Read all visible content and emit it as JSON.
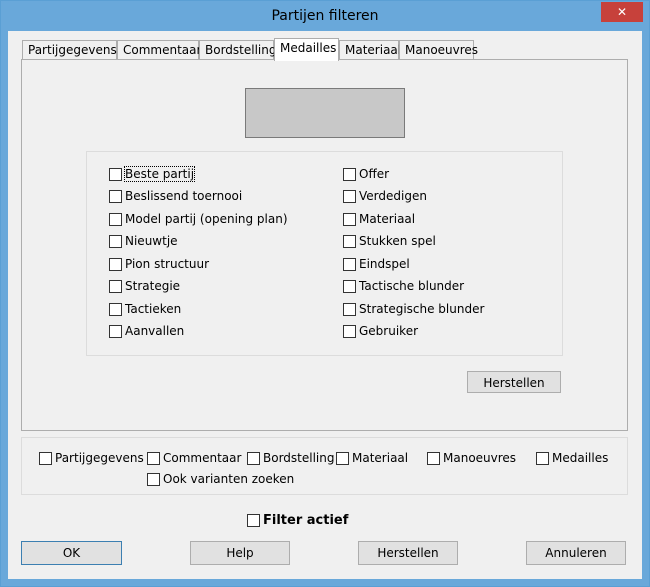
{
  "window": {
    "title": "Partijen filteren",
    "close_symbol": "✕"
  },
  "tabs": [
    {
      "label": "Partijgegevens",
      "active": false
    },
    {
      "label": "Commentaar",
      "active": false
    },
    {
      "label": "Bordstelling",
      "active": false
    },
    {
      "label": "Medailles",
      "active": true
    },
    {
      "label": "Materiaal",
      "active": false
    },
    {
      "label": "Manoeuvres",
      "active": false
    }
  ],
  "medals": {
    "left": [
      "Beste partij",
      "Beslissend toernooi",
      "Model partij (opening plan)",
      "Nieuwtje",
      "Pion structuur",
      "Strategie",
      "Tactieken",
      "Aanvallen"
    ],
    "right": [
      "Offer",
      "Verdedigen",
      "Materiaal",
      "Stukken spel",
      "Eindspel",
      "Tactische blunder",
      "Strategische blunder",
      "Gebruiker"
    ],
    "reset_label": "Herstellen"
  },
  "filters": {
    "items": [
      "Partijgegevens",
      "Commentaar",
      "Bordstelling",
      "Materiaal",
      "Manoeuvres",
      "Medailles"
    ],
    "variants_label": "Ook varianten zoeken"
  },
  "filter_active_label": "Filter actief",
  "buttons": {
    "ok": "OK",
    "help": "Help",
    "reset": "Herstellen",
    "cancel": "Annuleren"
  }
}
